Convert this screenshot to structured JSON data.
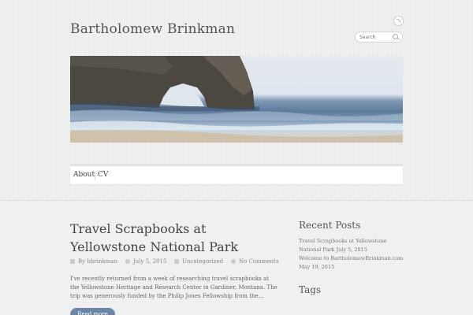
{
  "site": {
    "title": "Bartholomew Brinkman"
  },
  "search": {
    "placeholder": "Search"
  },
  "nav": {
    "items": [
      {
        "label": "About"
      },
      {
        "label": "CV"
      }
    ]
  },
  "post": {
    "title": "Travel Scrapbooks at Yellowstone National Park",
    "author_prefix": "By",
    "author": "bbrinkman",
    "date": "July 5, 2015",
    "category": "Uncategorized",
    "comments": "No Comments",
    "excerpt": "I've recently returned from a week of researching travel scrapbooks at the Yellowstone Heritage and Research Center in Gardiner, Montana. The trip was generously funded by the Philip Jones Fellowship from the…",
    "read_more": "Read more"
  },
  "sidebar": {
    "recent_posts_title": "Recent Posts",
    "recent_posts": [
      {
        "title": "Travel Scrapbooks at Yellowstone National Park",
        "date": "July 5, 2015"
      },
      {
        "title": "Welcome to BartholomewBrinkman.com",
        "date": "May 19, 2015"
      }
    ],
    "tags_title": "Tags"
  },
  "icons": {
    "rss": "rss-icon",
    "search": "search-icon",
    "author": "user-icon",
    "date": "clock-icon",
    "category": "tag-icon",
    "comments": "comment-icon"
  },
  "colors": {
    "accent": "#6e86a6",
    "text": "#555555"
  }
}
